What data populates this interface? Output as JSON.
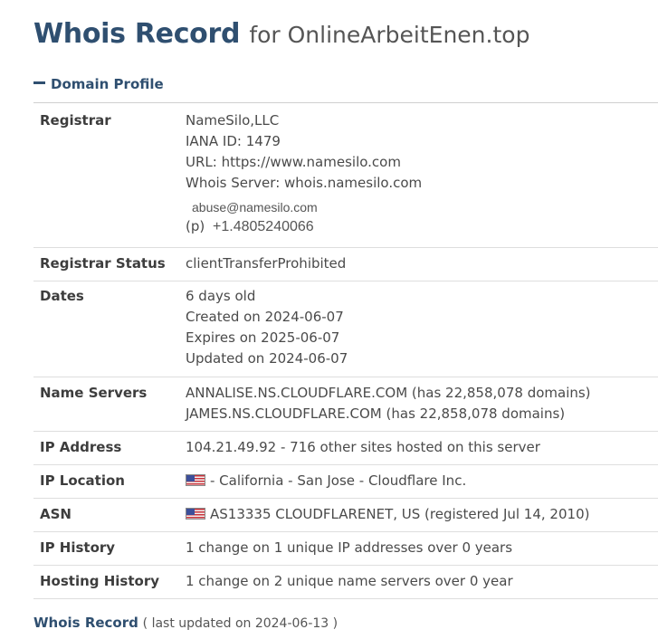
{
  "header": {
    "title": "Whois Record",
    "for_text": "for OnlineArbeitEnen.top"
  },
  "section": {
    "toggle_icon": "minus-icon",
    "label": "Domain Profile"
  },
  "rows": {
    "registrar": {
      "label": "Registrar",
      "name": "NameSilo,LLC",
      "iana": "IANA ID: 1479",
      "url": "URL: https://www.namesilo.com",
      "whois_server": "Whois Server: whois.namesilo.com",
      "email": "abuse@namesilo.com",
      "phone_prefix": "(p)",
      "phone": "+1.4805240066"
    },
    "status": {
      "label": "Registrar Status",
      "value": "clientTransferProhibited"
    },
    "dates": {
      "label": "Dates",
      "age": "6 days old",
      "created": "Created on 2024-06-07",
      "expires": "Expires on 2025-06-07",
      "updated": "Updated on 2024-06-07"
    },
    "name_servers": {
      "label": "Name Servers",
      "ns1": "ANNALISE.NS.CLOUDFLARE.COM (has 22,858,078 domains)",
      "ns2": "JAMES.NS.CLOUDFLARE.COM (has 22,858,078 domains)"
    },
    "ip_address": {
      "label": "IP Address",
      "value": "104.21.49.92 - 716 other sites hosted on this server"
    },
    "ip_location": {
      "label": "IP Location",
      "flag_icon": "us-flag-icon",
      "value": "- California - San Jose - Cloudflare Inc."
    },
    "asn": {
      "label": "ASN",
      "flag_icon": "us-flag-icon",
      "value": "AS13335 CLOUDFLARENET, US (registered Jul 14, 2010)"
    },
    "ip_history": {
      "label": "IP History",
      "value": "1 change on 1 unique IP addresses over 0 years"
    },
    "hosting_history": {
      "label": "Hosting History",
      "value": "1 change on 2 unique name servers over 0 year"
    }
  },
  "footer": {
    "title": "Whois Record",
    "note": "( last updated on 2024-06-13 )"
  },
  "colors": {
    "heading": "#2f4f70",
    "text": "#3d3d3d",
    "divider": "#dedede"
  }
}
